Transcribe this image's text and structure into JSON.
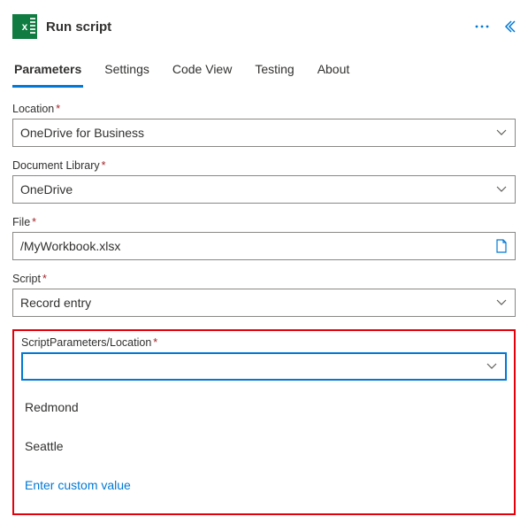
{
  "header": {
    "title": "Run script",
    "icon_letter": "x"
  },
  "tabs": {
    "items": [
      {
        "label": "Parameters",
        "active": true
      },
      {
        "label": "Settings"
      },
      {
        "label": "Code View"
      },
      {
        "label": "Testing"
      },
      {
        "label": "About"
      }
    ]
  },
  "form": {
    "location": {
      "label": "Location",
      "value": "OneDrive for Business"
    },
    "library": {
      "label": "Document Library",
      "value": "OneDrive"
    },
    "file": {
      "label": "File",
      "value": "/MyWorkbook.xlsx"
    },
    "script": {
      "label": "Script",
      "value": "Record entry"
    },
    "sp_location": {
      "label": "ScriptParameters/Location",
      "value": "",
      "options": [
        "Redmond",
        "Seattle"
      ],
      "custom_label": "Enter custom value"
    }
  }
}
